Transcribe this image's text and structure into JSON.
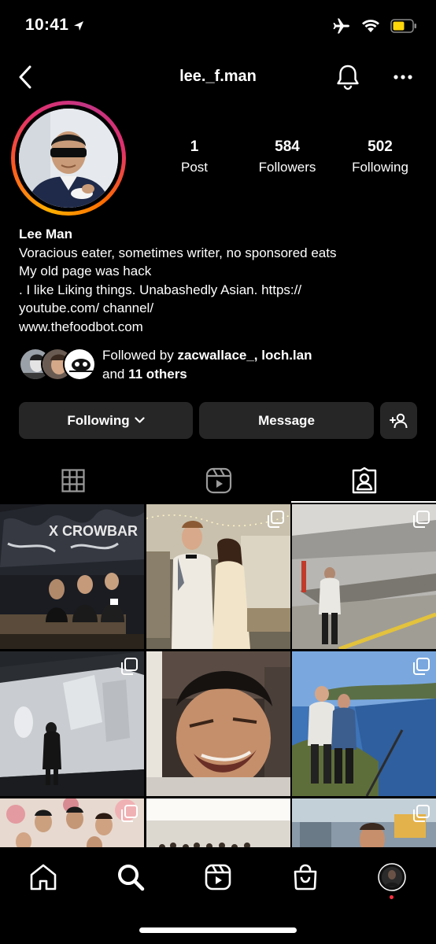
{
  "status": {
    "time": "10:41"
  },
  "header": {
    "username": "lee._f.man"
  },
  "profile": {
    "posts": {
      "count": "1",
      "label": "Post"
    },
    "followers": {
      "count": "584",
      "label": "Followers"
    },
    "following": {
      "count": "502",
      "label": "Following"
    },
    "name": "Lee Man",
    "bio_lines": [
      "Voracious eater, sometimes writer, no sponsored eats",
      "My old page was hack",
      ". I like Liking things. Unabashedly Asian. https://",
      "youtube.com/ channel/",
      "www.thefoodbot.com"
    ],
    "followed_by": {
      "prefix": "Followed by",
      "users": "zacwallace_, loch.lan",
      "and": "and",
      "others": "11 others"
    }
  },
  "actions": {
    "following_label": "Following",
    "message_label": "Message"
  },
  "tabs": [
    {
      "icon": "grid-icon"
    },
    {
      "icon": "reels-icon"
    },
    {
      "icon": "tagged-icon",
      "active": true
    }
  ],
  "nav": [
    "home-icon",
    "search-icon",
    "reels-icon",
    "shop-icon",
    "profile-avatar"
  ],
  "colors": {
    "accent_button": "#262626",
    "ring_start": "#ffb000",
    "ring_end": "#c13584",
    "notification_dot": "#ff3040"
  }
}
